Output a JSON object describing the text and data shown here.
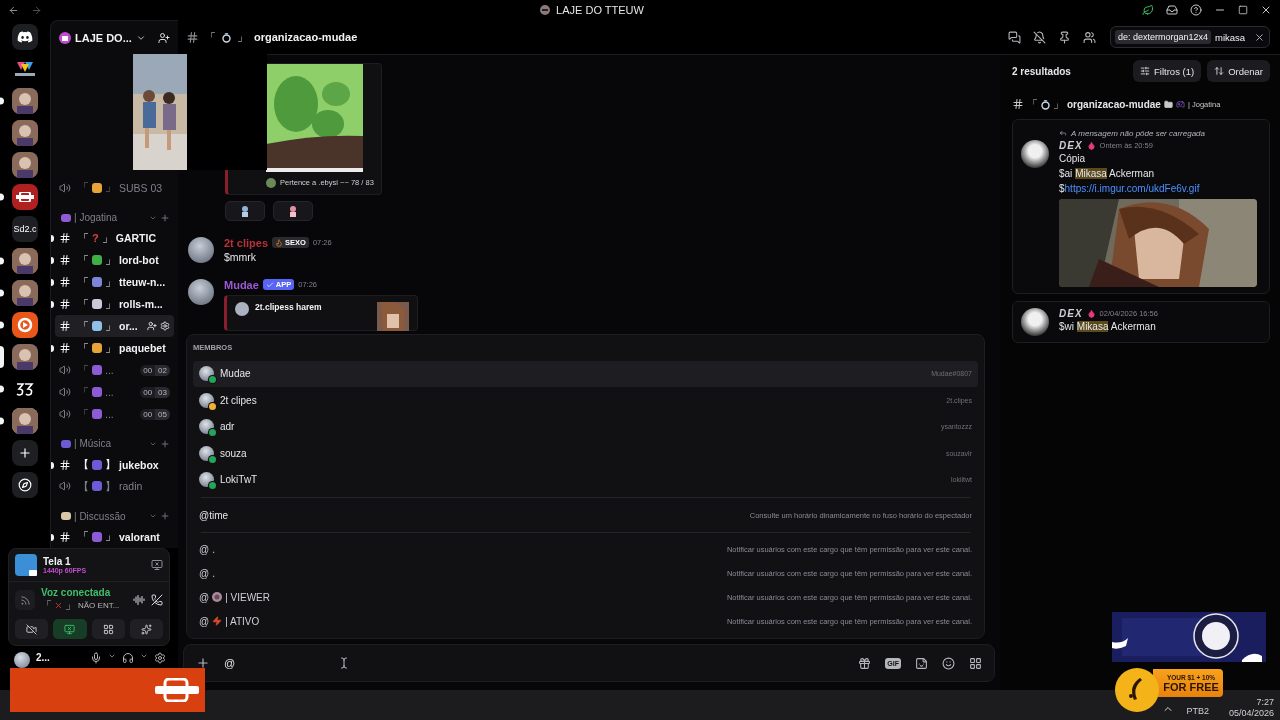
{
  "window": {
    "title": "LAJE DO TTEUW"
  },
  "servers": [
    {
      "kind": "home",
      "unread": false,
      "selected": false
    },
    {
      "kind": "logo",
      "unread": false,
      "selected": false
    },
    {
      "kind": "picture",
      "unread": true,
      "selected": false
    },
    {
      "kind": "picture",
      "unread": false,
      "selected": false
    },
    {
      "kind": "picture",
      "unread": false,
      "selected": false
    },
    {
      "kind": "badge",
      "unread": true,
      "selected": false
    },
    {
      "kind": "text",
      "label": "Sd2.c",
      "unread": false,
      "selected": false
    },
    {
      "kind": "picture",
      "unread": true,
      "selected": false
    },
    {
      "kind": "picture",
      "unread": true,
      "selected": false
    },
    {
      "kind": "orange",
      "unread": true,
      "selected": false
    },
    {
      "kind": "picture",
      "unread": false,
      "selected": true
    },
    {
      "kind": "mark",
      "unread": true,
      "selected": false
    },
    {
      "kind": "picture",
      "unread": true,
      "selected": false
    },
    {
      "kind": "add",
      "unread": false,
      "selected": false
    },
    {
      "kind": "explore",
      "unread": false,
      "selected": false
    }
  ],
  "server": {
    "name": "LAJE DO..."
  },
  "channels": [
    {
      "kind": "voice",
      "open": "「",
      "close": "」",
      "color": "#e8a23a",
      "name": "SUBS 03",
      "unread": false,
      "selected": false
    },
    {
      "kind": "category",
      "name": "| Jogatina",
      "color": "#8e5bd6",
      "expanded": true,
      "children": [
        {
          "kind": "text",
          "open": "「",
          "close": "」",
          "symbol": "?",
          "color": "#e0453a",
          "name": "GARTIC",
          "unread": true,
          "selected": false
        },
        {
          "kind": "text",
          "open": "「",
          "close": "」",
          "color": "#3fae49",
          "name": "lord-bot",
          "unread": true,
          "selected": false
        },
        {
          "kind": "text",
          "open": "「",
          "close": "」",
          "color": "#7b86d9",
          "name": "tteuw-n...",
          "unread": true,
          "selected": false
        },
        {
          "kind": "text",
          "open": "「",
          "close": "」",
          "color": "#c9c9d9",
          "name": "rolls-m...",
          "unread": true,
          "selected": false
        },
        {
          "kind": "text",
          "open": "「",
          "close": "」",
          "color": "#8fc0e8",
          "name": "or...",
          "unread": false,
          "selected": true
        },
        {
          "kind": "text",
          "open": "「",
          "close": "」",
          "color": "#e8a23a",
          "name": "paquebet",
          "unread": true,
          "selected": false
        },
        {
          "kind": "voice",
          "open": "「",
          "color": "#8e5bd6",
          "name": "...",
          "counts": [
            "00",
            "02"
          ],
          "unread": false,
          "selected": false
        },
        {
          "kind": "voice",
          "open": "「",
          "color": "#8e5bd6",
          "name": "...",
          "counts": [
            "00",
            "03"
          ],
          "unread": false,
          "selected": false
        },
        {
          "kind": "voice",
          "open": "「",
          "color": "#8e5bd6",
          "name": "...",
          "counts": [
            "00",
            "05"
          ],
          "unread": false,
          "selected": false
        }
      ]
    },
    {
      "kind": "category",
      "name": "| Música",
      "color": "#6b5bd6",
      "expanded": true,
      "children": [
        {
          "kind": "text",
          "open": "【",
          "close": "】",
          "color": "#6b5bd6",
          "name": "jukebox",
          "unread": true,
          "selected": false
        },
        {
          "kind": "voice",
          "open": "【",
          "close": "】",
          "color": "#6b5bd6",
          "name": "radin",
          "unread": false,
          "selected": false
        }
      ]
    },
    {
      "kind": "category",
      "name": "| Discussão",
      "color": "#d9c7a8",
      "expanded": true,
      "children": [
        {
          "kind": "text",
          "open": "「",
          "close": "」",
          "color": "#8e5bd6",
          "name": "valorant",
          "unread": true,
          "selected": false
        }
      ]
    }
  ],
  "voice_panel": {
    "stream_title": "Tela 1",
    "quality": "1440p 60FPS",
    "status": "Voz conectada",
    "open": "「",
    "close": "」",
    "channel": "NÃO ENT..."
  },
  "user": {
    "name": "2..."
  },
  "channel_header": {
    "open": "「",
    "close": "」",
    "name": "organizacao-mudae"
  },
  "search": {
    "filter": "de: dextermorgan12x4",
    "query": "mikasa"
  },
  "messages": [
    {
      "kind": "embed",
      "footer": "Pertence a .ebysi ~~ 78 / 83"
    },
    {
      "kind": "user",
      "author": "2t clipes",
      "color": "#b8323a",
      "tag": "SEXO",
      "time": "07:26",
      "text": "$mmrk"
    },
    {
      "kind": "bot",
      "author": "Mudae",
      "color": "#9b59d6",
      "tag": "APP",
      "time": "07:26",
      "embed_title": "2t.clipess harem"
    }
  ],
  "autocomplete": {
    "section": "MEMBROS",
    "members": [
      {
        "name": "Mudae",
        "handle": "Mudae#0807",
        "color": "#23a55a",
        "selected": true
      },
      {
        "name": "2t clipes",
        "handle": "2t.clipes",
        "color": "#f0b232",
        "selected": false
      },
      {
        "name": "adr",
        "handle": "ysantozzz",
        "color": "#23a55a",
        "selected": false
      },
      {
        "name": "souza",
        "handle": "souzavlr",
        "color": "#23a55a",
        "selected": false
      },
      {
        "name": "LokiTwT",
        "handle": "lokiitwt",
        "color": "#23a55a",
        "selected": false
      }
    ],
    "commands": [
      {
        "name": "@time",
        "description": "Consulte um horário dinamicamente no fuso horário do espectador"
      }
    ],
    "roles": [
      {
        "kind": "plain",
        "at": "@",
        "name": ".",
        "description": "Notificar usuários com este cargo que têm permissão para ver este canal."
      },
      {
        "kind": "plain",
        "at": "@",
        "name": ".",
        "description": "Notificar usuários com este cargo que têm permissão para ver este canal."
      },
      {
        "kind": "avatar",
        "at": "@",
        "name": "| VIEWER",
        "description": "Notificar usuários com este cargo que têm permissão para ver este canal."
      },
      {
        "kind": "bolt",
        "at": "@",
        "name": "| ATIVO",
        "description": "Notificar usuários com este cargo que têm permissão para ver este canal."
      }
    ]
  },
  "composer": {
    "value": "@",
    "gif": "GIF"
  },
  "results": {
    "count": "2 resultados",
    "filters": "Filtros (1)",
    "sort": "Ordenar",
    "channel": {
      "open": "「",
      "close": "」",
      "name": "organizacao-mudae",
      "category": "| Jogatina"
    },
    "items": [
      {
        "reply": "A mensagem não pôde ser carregada",
        "author": "DEX",
        "time": "Ontem às 20:59",
        "attachment": {
          "kind": "picture"
        },
        "lines": [
          [
            {
              "text": "Cópia"
            }
          ],
          [
            {
              "text": "$ai "
            },
            {
              "text": "Mikasa",
              "highlight": true
            },
            {
              "text": " Ackerman"
            }
          ],
          [
            {
              "text": "$"
            },
            {
              "text": "https://i.imgur.com/ukdFe6v.gif",
              "link": true
            }
          ]
        ]
      },
      {
        "author": "DEX",
        "time": "02/04/2026 16:56",
        "lines": [
          [
            {
              "text": "$wi "
            },
            {
              "text": "Mikasa",
              "highlight": true
            },
            {
              "text": " Ackerman"
            }
          ]
        ]
      }
    ]
  },
  "ad": {
    "line1": "YOUR $1 + 10%",
    "line2": "FOR FREE"
  },
  "taskbar": {
    "app": "PTB2",
    "time": "7:27",
    "date": "05/04/2026"
  }
}
